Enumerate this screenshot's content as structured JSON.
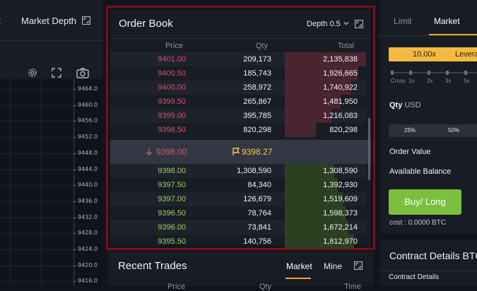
{
  "left_panel": {
    "tab_chart": "art",
    "tab_depth": "Market Depth",
    "ticks": [
      "9464.0",
      "9460.0",
      "9456.0",
      "9452.0",
      "9448.0",
      "9444.0",
      "9440.0",
      "9436.0",
      "9432.0",
      "9428.0",
      "9424.0",
      "9420.0",
      "9416.0"
    ]
  },
  "order_book": {
    "title": "Order Book",
    "depth_label": "Depth 0.5",
    "headers": {
      "price": "Price",
      "qty": "Qty",
      "total": "Total"
    },
    "asks": [
      {
        "price": "9401.00",
        "qty": "209,173",
        "total": "2,135,838",
        "depth": 1.0
      },
      {
        "price": "9400.50",
        "qty": "185,743",
        "total": "1,926,665",
        "depth": 0.9
      },
      {
        "price": "9400.00",
        "qty": "258,972",
        "total": "1,740,922",
        "depth": 0.82
      },
      {
        "price": "9399.50",
        "qty": "265,867",
        "total": "1,481,950",
        "depth": 0.69
      },
      {
        "price": "9399.00",
        "qty": "395,785",
        "total": "1,216,083",
        "depth": 0.57
      },
      {
        "price": "9398.50",
        "qty": "820,298",
        "total": "820,298",
        "depth": 0.38
      }
    ],
    "last_price": "9398.00",
    "mark_price": "9398.27",
    "bids": [
      {
        "price": "9398.00",
        "qty": "1,308,590",
        "total": "1,308,590",
        "depth": 0.61
      },
      {
        "price": "9397.50",
        "qty": "84,340",
        "total": "1,392,930",
        "depth": 0.65
      },
      {
        "price": "9397.00",
        "qty": "126,679",
        "total": "1,519,609",
        "depth": 0.71
      },
      {
        "price": "9396.50",
        "qty": "78,764",
        "total": "1,598,373",
        "depth": 0.75
      },
      {
        "price": "9396.00",
        "qty": "73,841",
        "total": "1,672,214",
        "depth": 0.78
      },
      {
        "price": "9395.50",
        "qty": "140,756",
        "total": "1,812,970",
        "depth": 0.85
      }
    ]
  },
  "recent_trades": {
    "title": "Recent Trades",
    "tab_market": "Market",
    "tab_mine": "Mine",
    "headers": {
      "price": "Price",
      "qty": "Qty",
      "time": "Time"
    }
  },
  "order_form": {
    "tab_limit": "Limit",
    "tab_market": "Market",
    "leverage_value": "10.00x",
    "leverage_label": "Leverage",
    "slider_labels": [
      "Cross",
      "1x",
      "2x",
      "3x",
      "5x"
    ],
    "qty_label": "Qty",
    "qty_unit": "USD",
    "pct_options": [
      "25%",
      "50%"
    ],
    "order_value_label": "Order Value",
    "available_balance_label": "Available Balance",
    "buy_button": "Buy/ Long",
    "cost": "cost : 0.0000 BTC"
  },
  "contract_details": {
    "title": "Contract Details BTC",
    "subtitle": "Contract Details"
  },
  "colors": {
    "ask": "#d0566e",
    "bid": "#9fd064",
    "accent": "#f5a623",
    "highlight_border": "#7a0f1a"
  }
}
